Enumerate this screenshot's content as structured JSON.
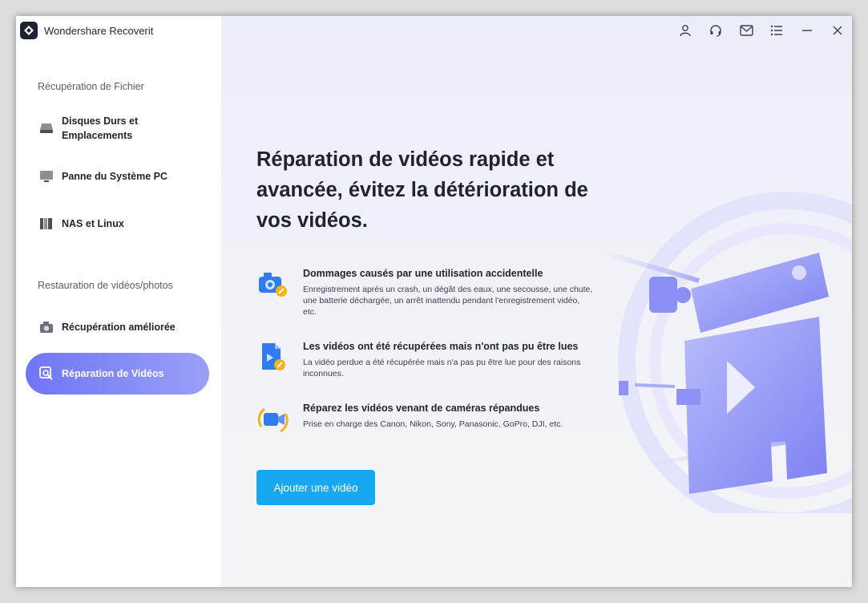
{
  "app": {
    "title": "Wondershare Recoverit"
  },
  "sidebar": {
    "sections": [
      {
        "title": "Récupération de Fichier"
      },
      {
        "title": "Restauration de vidéos/photos"
      }
    ],
    "items": [
      {
        "label": "Disques Durs et Emplacements",
        "icon": "hard-drive-icon"
      },
      {
        "label": "Panne du Système PC",
        "icon": "monitor-icon"
      },
      {
        "label": "NAS et Linux",
        "icon": "nas-icon"
      },
      {
        "label": "Récupération améliorée",
        "icon": "camera-icon"
      },
      {
        "label": "Réparation de Vidéos",
        "icon": "video-repair-icon",
        "active": true
      }
    ]
  },
  "titlebar": {
    "icons": [
      "user-icon",
      "headset-icon",
      "mail-icon",
      "menu-icon",
      "minimize-icon",
      "close-icon"
    ]
  },
  "main": {
    "headline": "Réparation de vidéos rapide et avancée, évitez la détérioration de vos vidéos.",
    "features": [
      {
        "title": "Dommages causés par une utilisation accidentelle",
        "text": "Enregistrement après un crash, un dégât des eaux, une secousse, une chute, une batterie déchargée, un arrêt inattendu pendant l'enregistrement vidéo, etc.",
        "icon": "damaged-camera-icon"
      },
      {
        "title": "Les vidéos ont été récupérées mais n'ont pas pu être lues",
        "text": "La vidéo perdue a été récupérée mais n'a pas pu être lue pour des raisons inconnues.",
        "icon": "corrupt-file-icon"
      },
      {
        "title": "Réparez les vidéos venant de caméras répandues",
        "text": "Prise en charge des Canon, Nikon, Sony, Panasonic, GoPro, DJI, etc.",
        "icon": "video-camera-icon"
      }
    ],
    "add_button": "Ajouter une vidéo"
  },
  "colors": {
    "accent": "#18a8f2",
    "active_nav": "#7a80f6",
    "illustration": "#8f8ff5"
  }
}
